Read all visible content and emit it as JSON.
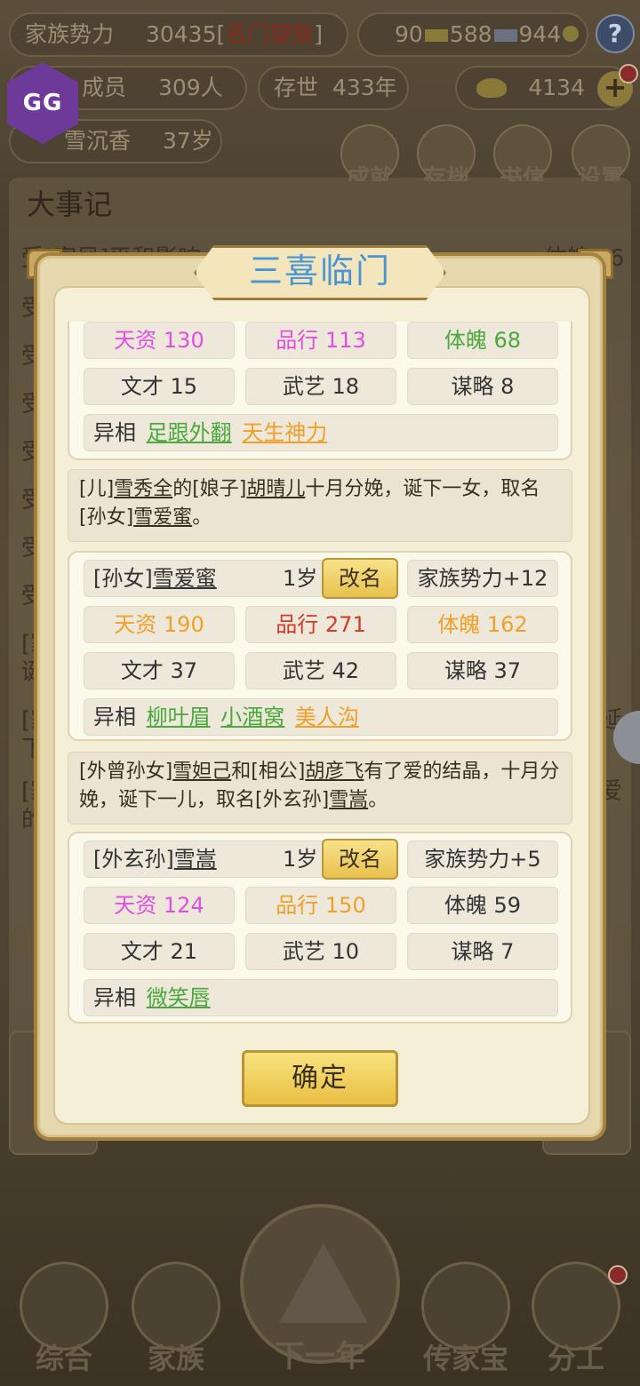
{
  "header": {
    "family_power_label": "家族势力",
    "family_power_value": "30435",
    "family_rank_open": "[",
    "family_rank": "名门望族",
    "family_rank_close": "]",
    "gold_bars": "90",
    "silver_bars": "588",
    "coins": "944",
    "help_label": "?",
    "members_label": "成员",
    "members_value": "309人",
    "existence_label": "存世",
    "existence_value": "433年",
    "ingots": "4134",
    "plus_label": "+",
    "patriarch_name": "雪沉香",
    "patriarch_age": "37岁",
    "overlay_logo": "GG"
  },
  "top_icons": [
    {
      "label": "成就",
      "icon": "achievement-icon"
    },
    {
      "label": "存档",
      "icon": "save-icon"
    },
    {
      "label": "书信",
      "icon": "letter-icon"
    },
    {
      "label": "设置",
      "icon": "settings-icon"
    }
  ],
  "chronicle": {
    "title": "大事记",
    "lines": [
      "受[家风]平和影响",
      "受",
      "受",
      "受",
      "受",
      "受",
      "受",
      "受",
      "[家",
      "诞",
      "[家",
      "下",
      "[家",
      "的"
    ],
    "right_fragment_1": "体魄+6",
    "right_fragment_2": "延",
    "right_fragment_3": "爱"
  },
  "modal": {
    "title": "三喜临门",
    "confirm_label": "确定",
    "cards": [
      {
        "stats_row1": [
          {
            "text": "天资 130",
            "color": "pink"
          },
          {
            "text": "品行 113",
            "color": "pink"
          },
          {
            "text": "体魄 68",
            "color": "green"
          }
        ],
        "stats_row2": [
          "文才 15",
          "武艺 18",
          "谋略 8"
        ],
        "trait_label": "异相",
        "traits": [
          {
            "text": "足跟外翻",
            "color": "green"
          },
          {
            "text": "天生神力",
            "color": "orange"
          }
        ]
      },
      {
        "event_parts": [
          "[儿]",
          "雪秀全",
          "的[娘子]",
          "胡晴儿",
          "十月分娩，诞下一女，取名[孙女]",
          "雪爱蜜",
          "。"
        ],
        "name_prefix": "[孙女]",
        "name": "雪爱蜜",
        "age": "1岁",
        "rename_label": "改名",
        "power_bonus": "家族势力+12",
        "stats_row1": [
          {
            "text": "天资 190",
            "color": "orange"
          },
          {
            "text": "品行 271",
            "color": "red"
          },
          {
            "text": "体魄 162",
            "color": "orange"
          }
        ],
        "stats_row2": [
          "文才 37",
          "武艺 42",
          "谋略 37"
        ],
        "trait_label": "异相",
        "traits": [
          {
            "text": "柳叶眉",
            "color": "green"
          },
          {
            "text": "小酒窝",
            "color": "green"
          },
          {
            "text": "美人沟",
            "color": "orange"
          }
        ]
      },
      {
        "event_parts": [
          "[外曾孙女]",
          "雪妲己",
          "和[相公]",
          "胡彦飞",
          "有了爱的结晶，十月分娩，诞下一儿，取名[外玄孙]",
          "雪嵩",
          "。"
        ],
        "name_prefix": "[外玄孙]",
        "name": "雪嵩",
        "age": "1岁",
        "rename_label": "改名",
        "power_bonus": "家族势力+5",
        "stats_row1": [
          {
            "text": "天资 124",
            "color": "pink"
          },
          {
            "text": "品行 150",
            "color": "orange"
          },
          {
            "text": "体魄 59",
            "color": "plain"
          }
        ],
        "stats_row2": [
          "文才 21",
          "武艺 10",
          "谋略 7"
        ],
        "trait_label": "异相",
        "traits": [
          {
            "text": "微笑唇",
            "color": "green"
          }
        ]
      }
    ]
  },
  "bottom_nav": [
    {
      "label": "综合",
      "icon": "scroll-icon"
    },
    {
      "label": "家族",
      "icon": "house-icon"
    },
    {
      "label": "下一年",
      "icon": "mountain-icon"
    },
    {
      "label": "传家宝",
      "icon": "treasure-icon"
    },
    {
      "label": "分工",
      "icon": "people-icon"
    }
  ],
  "colors": {
    "pink": "#e14ee0",
    "green": "#4aa83c",
    "orange": "#f0a028",
    "red": "#d23b28",
    "title_blue": "#4a95d4"
  }
}
